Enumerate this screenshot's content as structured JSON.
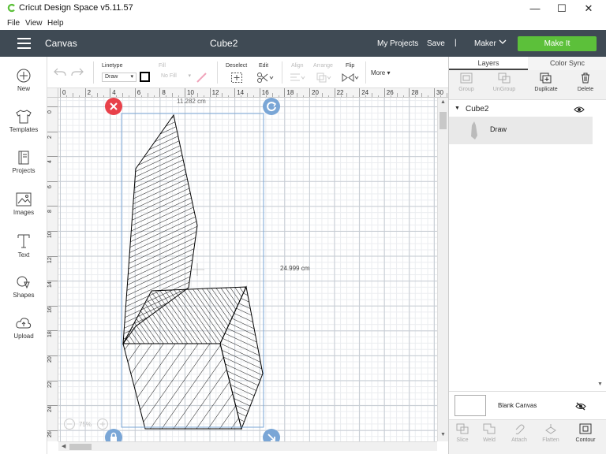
{
  "window": {
    "title": "Cricut Design Space  v5.11.57",
    "minimize": "—",
    "maximize": "☐",
    "close": "✕"
  },
  "menu": [
    "File",
    "View",
    "Help"
  ],
  "header": {
    "section": "Canvas",
    "project_title": "Cube2",
    "my_projects": "My Projects",
    "save": "Save",
    "separator": "|",
    "machine": "Maker",
    "make_it": "Make It"
  },
  "left_tools": [
    {
      "label": "New",
      "icon": "plus-circle-icon"
    },
    {
      "label": "Templates",
      "icon": "shirt-icon"
    },
    {
      "label": "Projects",
      "icon": "book-icon"
    },
    {
      "label": "Images",
      "icon": "image-icon"
    },
    {
      "label": "Text",
      "icon": "text-icon"
    },
    {
      "label": "Shapes",
      "icon": "shapes-icon"
    },
    {
      "label": "Upload",
      "icon": "upload-cloud-icon"
    }
  ],
  "toolbar": {
    "linetype_label": "Linetype",
    "linetype_value": "Draw",
    "fill_label": "Fill",
    "fill_value": "No Fill",
    "deselect": "Deselect",
    "edit": "Edit",
    "align": "Align",
    "arrange": "Arrange",
    "flip": "Flip",
    "more": "More"
  },
  "ruler": {
    "top": [
      "0",
      "2",
      "4",
      "6",
      "8",
      "10",
      "12",
      "14",
      "16",
      "18",
      "20",
      "22",
      "24",
      "26",
      "28",
      "30"
    ],
    "left": [
      "0",
      "2",
      "4",
      "6",
      "8",
      "10",
      "12",
      "14",
      "16",
      "18",
      "20",
      "22",
      "24",
      "26"
    ]
  },
  "canvas": {
    "width_dim": "11.282 cm",
    "height_dim": "24.999 cm",
    "zoom": "75%"
  },
  "panel": {
    "tabs": [
      "Layers",
      "Color Sync"
    ],
    "actions": [
      {
        "label": "Group",
        "enabled": false,
        "icon": "group-icon"
      },
      {
        "label": "UnGroup",
        "enabled": false,
        "icon": "ungroup-icon"
      },
      {
        "label": "Duplicate",
        "enabled": true,
        "icon": "duplicate-icon"
      },
      {
        "label": "Delete",
        "enabled": true,
        "icon": "trash-icon"
      }
    ],
    "group_name": "Cube2",
    "layer_name": "Draw",
    "blank_canvas": "Blank Canvas",
    "bottom_actions": [
      {
        "label": "Slice",
        "enabled": false
      },
      {
        "label": "Weld",
        "enabled": false
      },
      {
        "label": "Attach",
        "enabled": false
      },
      {
        "label": "Flatten",
        "enabled": false
      },
      {
        "label": "Contour",
        "enabled": true
      }
    ]
  },
  "colors": {
    "header_bg": "#3f4a54",
    "make_it": "#5cc03a",
    "delete_handle": "#e8414a",
    "handle_blue": "#7aa6d6"
  }
}
